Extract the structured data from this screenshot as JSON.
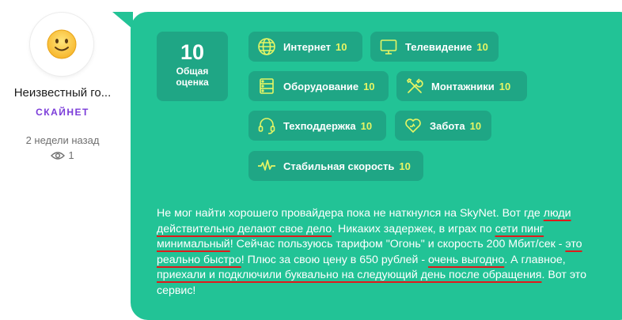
{
  "author": {
    "name": "Неизвестный го...",
    "company": "СКАЙНЕТ",
    "date": "2 недели назад",
    "views": "1"
  },
  "score": {
    "value": "10",
    "caption_line1": "Общая",
    "caption_line2": "оценка"
  },
  "ratings": [
    {
      "label": "Интернет",
      "value": "10",
      "icon": "globe-icon"
    },
    {
      "label": "Телевидение",
      "value": "10",
      "icon": "tv-icon"
    },
    {
      "label": "Оборудование",
      "value": "10",
      "icon": "server-icon"
    },
    {
      "label": "Монтажники",
      "value": "10",
      "icon": "tools-icon"
    },
    {
      "label": "Техподдержка",
      "value": "10",
      "icon": "headset-icon"
    },
    {
      "label": "Забота",
      "value": "10",
      "icon": "heart-icon"
    },
    {
      "label": "Стабильная скорость",
      "value": "10",
      "icon": "pulse-icon"
    }
  ],
  "review": {
    "p1": "Не мог найти хорошего провайдера пока не наткнулся на SkyNet. Вот где ",
    "u1": "люди действительно делают свое дело",
    "p2": ". Никаких задержек, в играх по ",
    "u2": "сети пинг минимальный",
    "p3": "! Сейчас пользуюсь тарифом \"Огонь\" и скорость 200 Мбит/сек - ",
    "u3": "это реально быстро",
    "p4": "! Плюс за свою цену в 650 рублей - ",
    "u4": "очень выгодно",
    "p5": ". А главное, ",
    "u5": "приехали и подключили буквально на следующий день после обращения",
    "p6": ". Вот это сервис!"
  },
  "colors": {
    "card": "#22c396",
    "tile": "#1fa685",
    "value": "#e6f564",
    "company": "#7b3cd9",
    "underline": "#e01b1b"
  }
}
